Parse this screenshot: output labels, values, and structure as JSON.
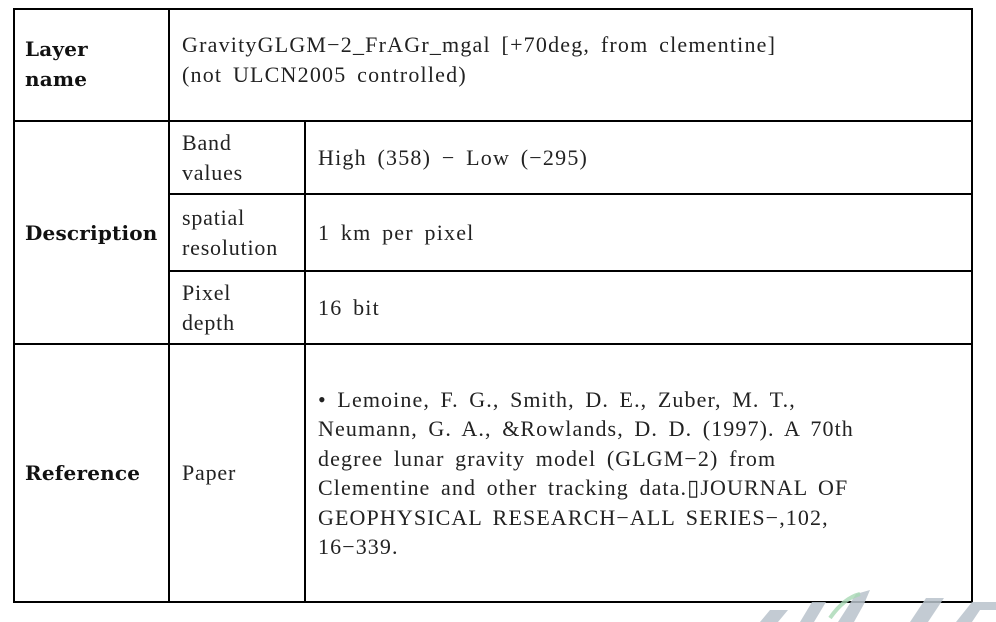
{
  "table": {
    "rows": [
      {
        "header": "Layer\nname",
        "value_lines": [
          "GravityGLGM−2_FrAGr_mgal [+70deg, from clementine]",
          "(not ULCN2005 controlled)"
        ]
      },
      {
        "header": "Description",
        "subrows": [
          {
            "label_lines": [
              "Band",
              "values"
            ],
            "value": "High (358) − Low (−295)"
          },
          {
            "label_lines": [
              "spatial",
              "resolution"
            ],
            "value": "1 km per pixel"
          },
          {
            "label_lines": [
              "Pixel",
              "depth"
            ],
            "value": "16 bit"
          }
        ]
      },
      {
        "header": "Reference",
        "subrows": [
          {
            "label": "Paper",
            "bullet": "•",
            "value_lines": [
              "Lemoine, F. G., Smith, D. E., Zuber, M. T.,",
              "Neumann, G. A., &Rowlands, D. D. (1997). A 70th",
              "degree lunar gravity model (GLGM−2) from",
              "Clementine and other tracking data.▯JOURNAL OF",
              "GEOPHYSICAL RESEARCH−ALL SERIES−,102,",
              "16−339."
            ]
          }
        ]
      }
    ],
    "header_labels": {
      "layer": "Layer",
      "name": "name"
    }
  },
  "watermark": {
    "icon": "institution-logo-watermark"
  }
}
